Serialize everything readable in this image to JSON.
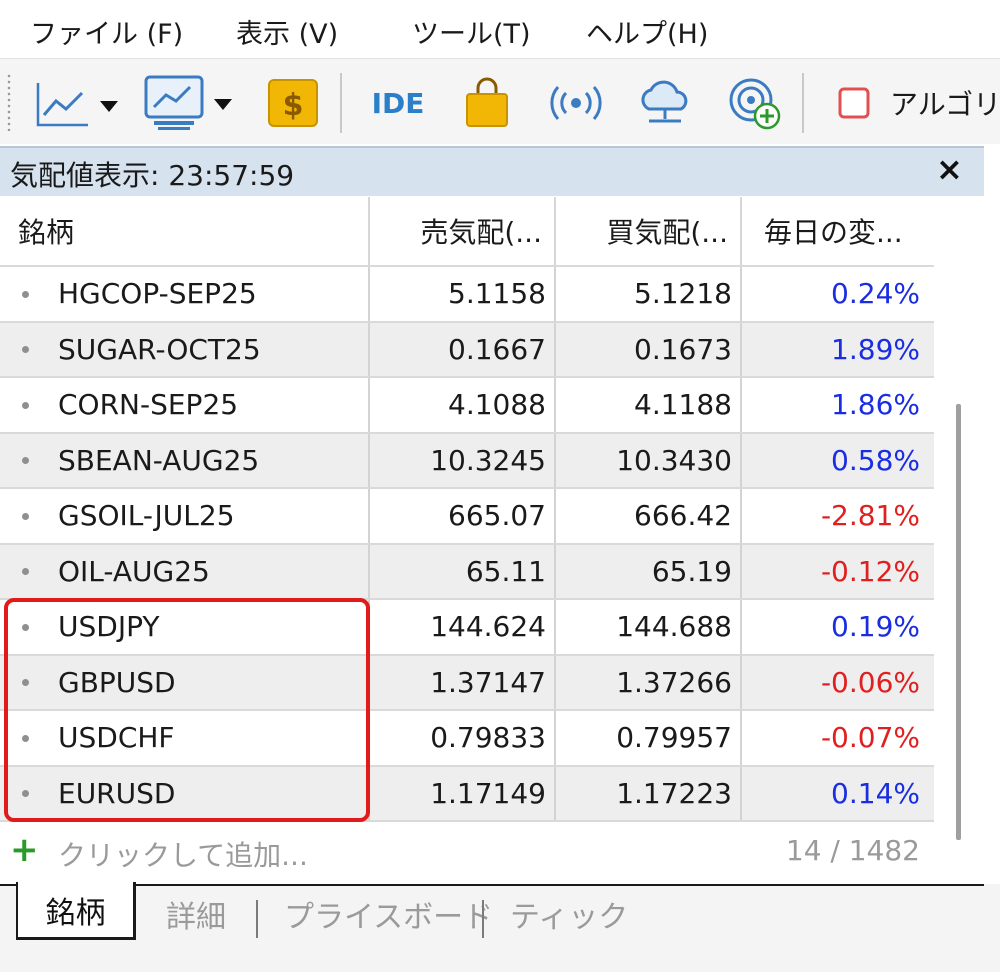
{
  "menu": {
    "file": "ファイル (F)",
    "view": "表示 (V)",
    "tools": "ツール(T)",
    "help": "ヘルプ(H)"
  },
  "toolbar": {
    "ide_label": "IDE",
    "algo_label": "アルゴリズ",
    "icons": [
      "line-chart-icon",
      "chart-template-icon",
      "dollar-icon",
      "market-bag-icon",
      "signals-icon",
      "cloud-icon",
      "vps-icon"
    ],
    "colors": {
      "dollar": "#f2b705",
      "bag": "#f2b705",
      "blue": "#2a7fc8",
      "algo_box": "#e05050"
    }
  },
  "panel": {
    "title": "気配値表示: 23:57:59",
    "close": "×"
  },
  "table": {
    "headers": [
      "銘柄",
      "売気配(...",
      "買気配(...",
      "毎日の変..."
    ],
    "rows": [
      {
        "symbol": "HGCOP-SEP25",
        "bid": "5.1158",
        "ask": "5.1218",
        "change": "0.24%",
        "dir": "pos"
      },
      {
        "symbol": "SUGAR-OCT25",
        "bid": "0.1667",
        "ask": "0.1673",
        "change": "1.89%",
        "dir": "pos"
      },
      {
        "symbol": "CORN-SEP25",
        "bid": "4.1088",
        "ask": "4.1188",
        "change": "1.86%",
        "dir": "pos"
      },
      {
        "symbol": "SBEAN-AUG25",
        "bid": "10.3245",
        "ask": "10.3430",
        "change": "0.58%",
        "dir": "pos"
      },
      {
        "symbol": "GSOIL-JUL25",
        "bid": "665.07",
        "ask": "666.42",
        "change": "-2.81%",
        "dir": "neg"
      },
      {
        "symbol": "OIL-AUG25",
        "bid": "65.11",
        "ask": "65.19",
        "change": "-0.12%",
        "dir": "neg"
      },
      {
        "symbol": "USDJPY",
        "bid": "144.624",
        "ask": "144.688",
        "change": "0.19%",
        "dir": "pos"
      },
      {
        "symbol": "GBPUSD",
        "bid": "1.37147",
        "ask": "1.37266",
        "change": "-0.06%",
        "dir": "neg"
      },
      {
        "symbol": "USDCHF",
        "bid": "0.79833",
        "ask": "0.79957",
        "change": "-0.07%",
        "dir": "neg"
      },
      {
        "symbol": "EURUSD",
        "bid": "1.17149",
        "ask": "1.17223",
        "change": "0.14%",
        "dir": "pos"
      }
    ],
    "add_label": "クリックして追加...",
    "count": "14 / 1482",
    "colors": {
      "positive": "#1a2de0",
      "negative": "#e02020",
      "highlight": "#e11b1b"
    }
  },
  "tabs": {
    "active": "銘柄",
    "details": "詳細",
    "priceboard": "プライスボード",
    "tick": "ティック"
  }
}
